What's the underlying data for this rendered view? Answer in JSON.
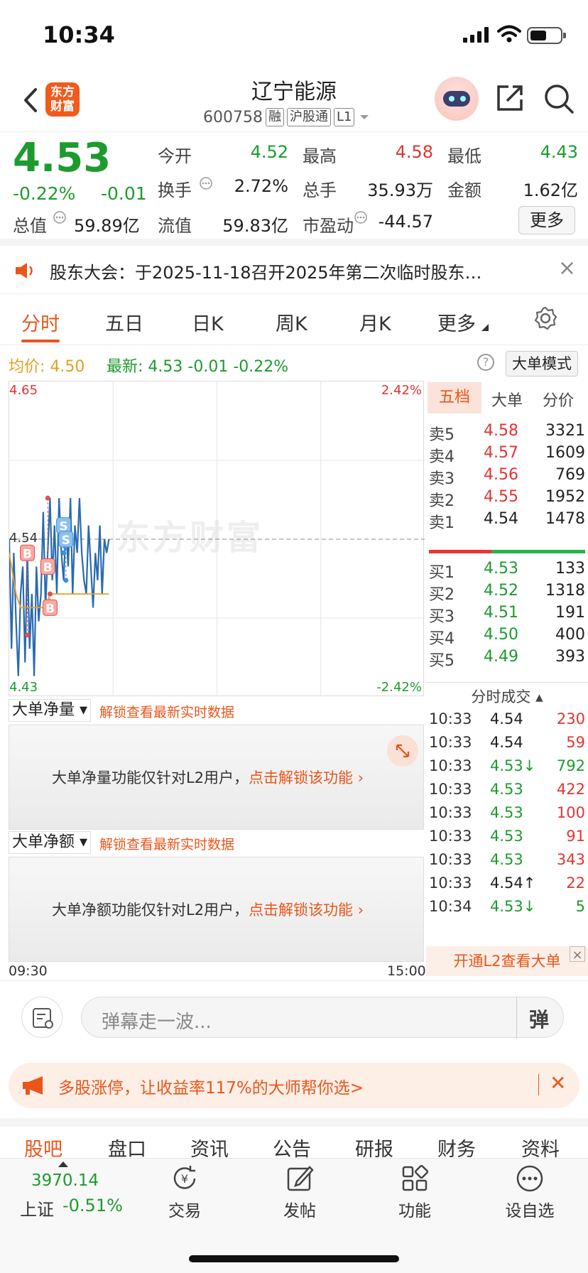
{
  "status": {
    "time": "10:34"
  },
  "header": {
    "logo_text": "东方\n财富",
    "name": "辽宁能源",
    "code": "600758",
    "tags": [
      "融",
      "沪股通",
      "L1"
    ]
  },
  "quote": {
    "price": "4.53",
    "pct": "-0.22%",
    "change": "-0.01",
    "fields": [
      {
        "label": "今开",
        "value": "4.52",
        "color": "#1d9b2e"
      },
      {
        "label": "最高",
        "value": "4.58",
        "color": "#e33333"
      },
      {
        "label": "最低",
        "value": "4.43",
        "color": "#1d9b2e"
      },
      {
        "label": "换手",
        "value": "2.72%",
        "color": "#222222"
      },
      {
        "label": "总手",
        "value": "35.93万",
        "color": "#222222"
      },
      {
        "label": "金额",
        "value": "1.62亿",
        "color": "#222222"
      },
      {
        "label": "流值",
        "value": "59.83亿",
        "color": "#222222"
      },
      {
        "label": "市盈动",
        "value": "-44.57",
        "color": "#222222"
      }
    ],
    "total_label": "总值",
    "total_value": "59.89亿",
    "more": "更多"
  },
  "notice": {
    "text": "股东大会：于2025-11-18召开2025年第二次临时股东…"
  },
  "chart_tabs": [
    "分时",
    "五日",
    "日K",
    "周K",
    "月K",
    "更多"
  ],
  "info_line": {
    "avg_label": "均价:",
    "avg_value": "4.50",
    "latest_label": "最新:",
    "latest_value": "4.53",
    "latest_change": "-0.01",
    "latest_pct": "-0.22%",
    "big_mode": "大单模式"
  },
  "chart_data": {
    "type": "line",
    "title": "",
    "ylim": [
      4.43,
      4.65
    ],
    "y_left_top": "4.65",
    "y_left_mid": "4.54",
    "y_left_bottom": "4.43",
    "y_right_top": "2.42%",
    "y_right_bottom": "-2.42%",
    "x_start": "09:30",
    "x_end": "15:00",
    "watermark": "东方财富",
    "series": [
      {
        "name": "最新",
        "color": "#2a6ab0",
        "values": [
          4.54,
          4.46,
          4.53,
          4.48,
          4.44,
          4.5,
          4.52,
          4.45,
          4.53,
          4.46,
          4.5,
          4.44,
          4.52,
          4.48,
          4.5,
          4.56,
          4.49,
          4.53,
          4.57,
          4.51,
          4.55,
          4.5,
          4.57,
          4.53,
          4.51,
          4.55,
          4.52,
          4.57,
          4.5,
          4.55,
          4.53,
          4.57,
          4.53,
          4.51,
          4.5,
          4.55,
          4.52,
          4.49,
          4.53,
          4.51,
          4.55,
          4.5,
          4.54,
          4.53,
          4.54
        ]
      },
      {
        "name": "均价",
        "color": "#e8a020",
        "values": [
          4.53,
          4.52,
          4.51,
          4.5,
          4.495,
          4.49,
          4.49,
          4.49,
          4.49,
          4.49,
          4.49,
          4.49,
          4.49,
          4.49,
          4.49,
          4.49,
          4.495,
          4.495,
          4.5,
          4.5,
          4.5,
          4.5,
          4.5,
          4.5,
          4.5,
          4.5,
          4.5,
          4.5,
          4.5,
          4.5,
          4.5,
          4.5,
          4.5,
          4.5,
          4.5,
          4.5,
          4.5,
          4.5,
          4.5,
          4.5,
          4.5,
          4.5,
          4.5,
          4.5,
          4.5
        ]
      }
    ],
    "markers": [
      "B",
      "B",
      "B",
      "S",
      "S"
    ]
  },
  "sub_panels": [
    {
      "select": "大单净量",
      "unlock": "解锁查看最新实时数据",
      "msg": "大单净量功能仅针对L2用户，",
      "link": "点击解锁该功能"
    },
    {
      "select": "大单净额",
      "unlock": "解锁查看最新实时数据",
      "msg": "大单净额功能仅针对L2用户，",
      "link": "点击解锁该功能"
    }
  ],
  "orderbook": {
    "tabs": [
      "五档",
      "大单",
      "分价"
    ],
    "asks": [
      {
        "label": "卖5",
        "price": "4.58",
        "vol": "3321",
        "color": "#e33333"
      },
      {
        "label": "卖4",
        "price": "4.57",
        "vol": "1609",
        "color": "#e33333"
      },
      {
        "label": "卖3",
        "price": "4.56",
        "vol": "769",
        "color": "#e33333"
      },
      {
        "label": "卖2",
        "price": "4.55",
        "vol": "1952",
        "color": "#e33333"
      },
      {
        "label": "卖1",
        "price": "4.54",
        "vol": "1478",
        "color": "#222222"
      }
    ],
    "bids": [
      {
        "label": "买1",
        "price": "4.53",
        "vol": "133",
        "color": "#1d9b2e"
      },
      {
        "label": "买2",
        "price": "4.52",
        "vol": "1318",
        "color": "#1d9b2e"
      },
      {
        "label": "买3",
        "price": "4.51",
        "vol": "191",
        "color": "#1d9b2e"
      },
      {
        "label": "买4",
        "price": "4.50",
        "vol": "400",
        "color": "#1d9b2e"
      },
      {
        "label": "买5",
        "price": "4.49",
        "vol": "393",
        "color": "#1d9b2e"
      }
    ],
    "ticks_title": "分时成交",
    "ticks": [
      {
        "t": "10:33",
        "p": "4.54",
        "v": "230",
        "pc": "#222222",
        "vc": "#e33333"
      },
      {
        "t": "10:33",
        "p": "4.54",
        "v": "59",
        "pc": "#222222",
        "vc": "#e33333"
      },
      {
        "t": "10:33",
        "p": "4.53↓",
        "v": "792",
        "pc": "#1d9b2e",
        "vc": "#1d9b2e"
      },
      {
        "t": "10:33",
        "p": "4.53",
        "v": "422",
        "pc": "#1d9b2e",
        "vc": "#e33333"
      },
      {
        "t": "10:33",
        "p": "4.53",
        "v": "100",
        "pc": "#1d9b2e",
        "vc": "#e33333"
      },
      {
        "t": "10:33",
        "p": "4.53",
        "v": "91",
        "pc": "#1d9b2e",
        "vc": "#e33333"
      },
      {
        "t": "10:33",
        "p": "4.53",
        "v": "343",
        "pc": "#1d9b2e",
        "vc": "#e33333"
      },
      {
        "t": "10:33",
        "p": "4.54↑",
        "v": "22",
        "pc": "#222222",
        "vc": "#e33333"
      },
      {
        "t": "10:34",
        "p": "4.53↓",
        "v": "5",
        "pc": "#1d9b2e",
        "vc": "#1d9b2e"
      }
    ],
    "open_l2": "开通L2查看大单"
  },
  "danmu": {
    "placeholder": "弹幕走一波...",
    "button": "弹"
  },
  "promo": {
    "text": "多股涨停，让收益率117%的大师帮你选>"
  },
  "sub_tabs": [
    "股吧",
    "盘口",
    "资讯",
    "公告",
    "研报",
    "财务",
    "资料"
  ],
  "bottom_nav": {
    "index_value": "3970.14",
    "index_name": "上证",
    "index_pct": "-0.51%",
    "items": [
      "交易",
      "发帖",
      "功能",
      "设自选"
    ]
  }
}
